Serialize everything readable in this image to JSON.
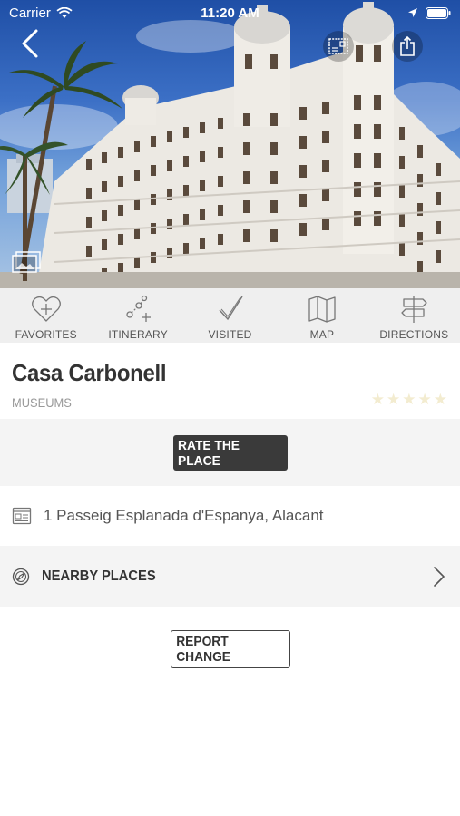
{
  "status_bar": {
    "carrier": "Carrier",
    "time": "11:20 AM"
  },
  "actions": [
    {
      "label": "FAVORITES",
      "icon": "heart-plus-icon"
    },
    {
      "label": "ITINERARY",
      "icon": "itinerary-icon"
    },
    {
      "label": "VISITED",
      "icon": "checkmark-icon"
    },
    {
      "label": "MAP",
      "icon": "map-icon"
    },
    {
      "label": "DIRECTIONS",
      "icon": "signpost-icon"
    }
  ],
  "place": {
    "name": "Casa Carbonell",
    "category": "MUSEUMS",
    "rating": 0,
    "rating_max": 5,
    "star_color": "#f3ecd0"
  },
  "rate": {
    "label": "RATE THE PLACE"
  },
  "address": {
    "text": "1 Passeig Esplanada d'Espanya, Alacant"
  },
  "nearby": {
    "label": "NEARBY PLACES"
  },
  "report": {
    "label": "REPORT CHANGE"
  },
  "colors": {
    "rate_button_bg": "#3a3a3a",
    "band_bg": "#f4f4f4",
    "action_bar_bg": "#efefef"
  }
}
